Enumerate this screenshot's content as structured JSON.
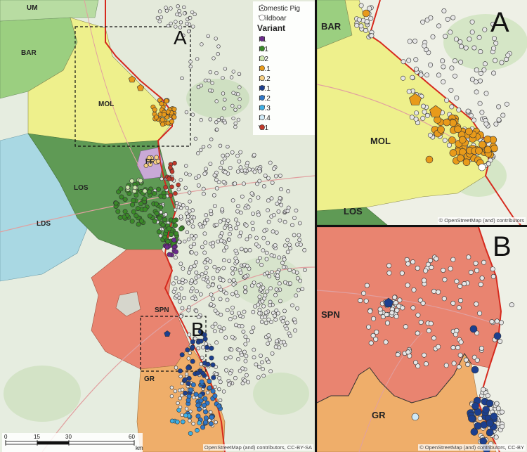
{
  "legend": {
    "domestic_pig": "Domestic Pig",
    "wildboar": "Wildboar",
    "title": "Variant",
    "variants": [
      {
        "label": "I.1",
        "color": "#6b2a8c"
      },
      {
        "label": "II.1",
        "color": "#3a8a28"
      },
      {
        "label": "II.2",
        "color": "#cfe6b0"
      },
      {
        "label": "III.1",
        "color": "#e89a1a"
      },
      {
        "label": "III.2",
        "color": "#f7cf82"
      },
      {
        "label": "IV.1",
        "color": "#1c3f8f"
      },
      {
        "label": "IV.2",
        "color": "#2f77c8"
      },
      {
        "label": "IV.3",
        "color": "#3fb0e6"
      },
      {
        "label": "IV.4",
        "color": "#cfe9f7"
      },
      {
        "label": "V.1",
        "color": "#c0392b"
      }
    ]
  },
  "regions": {
    "um": "UM",
    "bar": "BAR",
    "mol": "MOL",
    "ff": "FF",
    "los": "LOS",
    "lds": "LDS",
    "spn": "SPN",
    "gr": "GR"
  },
  "boxes": {
    "a": "A",
    "b": "B"
  },
  "scale": {
    "ticks": [
      "0",
      "15",
      "30",
      "60"
    ],
    "unit": "km"
  },
  "credits": {
    "main": "OpenStreetMap (and) contributors, CC-BY-SA",
    "inset_a": "© OpenStreetMap (and) contributors",
    "inset_b": "© OpenStreetMap (and) contributors, CC-BY"
  },
  "colors": {
    "border": "#d62a1e",
    "mol": "#eef08c",
    "los": "#5f9a55",
    "lds": "#a9d8e3",
    "ff": "#c9a9d6",
    "spn": "#e98470",
    "gr": "#efae6a",
    "bar": "#9bcf80",
    "background": "#e6ede0",
    "wildboar": "#e6e6e6"
  }
}
